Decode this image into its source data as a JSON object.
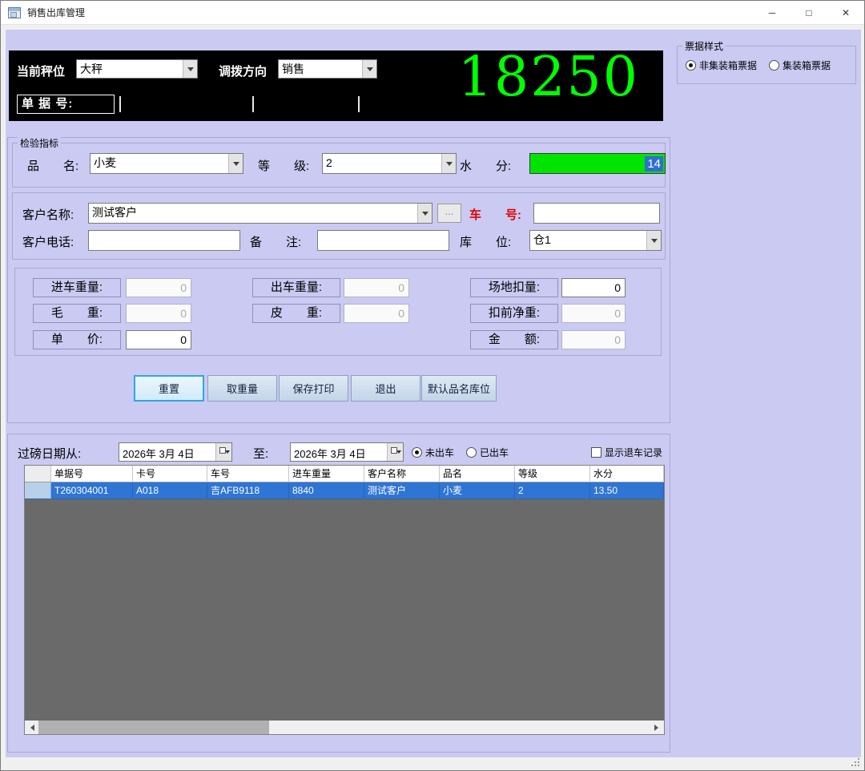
{
  "window": {
    "title": "销售出库管理",
    "controls": {
      "minimize": "─",
      "maximize": "□",
      "close": "✕"
    }
  },
  "scale_panel": {
    "scale_label": "当前秤位",
    "scale_value": "大秤",
    "direction_label": "调拨方向",
    "direction_value": "销售",
    "weight_display": "18250",
    "receipt_label": "单 据 号:"
  },
  "ticket_style": {
    "title": "票据样式",
    "option_non_container": "非集装箱票据",
    "option_container": "集装箱票据"
  },
  "inspection": {
    "title": "检验指标",
    "product_label": "品　　名:",
    "product_value": "小麦",
    "grade_label": "等　　级:",
    "grade_value": "2",
    "moisture_label": "水　　分:",
    "moisture_value": "14"
  },
  "customer": {
    "name_label": "客户名称:",
    "name_value": "测试客户",
    "browse_button": "...",
    "vehicle_label": "车　　号:",
    "vehicle_value": "",
    "phone_label": "客户电话:",
    "phone_value": "",
    "remark_label": "备　　注:",
    "remark_value": "",
    "warehouse_label": "库　　位:",
    "warehouse_value": "仓1"
  },
  "weights": {
    "in_label": "进车重量:",
    "in_value": "0",
    "out_label": "出车重量:",
    "out_value": "0",
    "site_deduct_label": "场地扣量:",
    "site_deduct_value": "0",
    "gross_label": "毛　　重:",
    "gross_value": "0",
    "tare_label": "皮　　重:",
    "tare_value": "0",
    "pre_net_label": "扣前净重:",
    "pre_net_value": "0",
    "price_label": "单　　价:",
    "price_value": "0",
    "amount_label": "金　　额:",
    "amount_value": "0"
  },
  "actions": {
    "reset": "重置",
    "get_weight": "取重量",
    "save_print": "保存打印",
    "exit": "退出",
    "default_product": "默认品名库位"
  },
  "filter": {
    "date_from_label": "过磅日期从:",
    "date_from_value": "2026年 3月 4日",
    "to_label": "至:",
    "date_to_value": "2026年 3月 4日",
    "not_out_label": "未出车",
    "out_label": "已出车",
    "show_return_label": "显示退车记录"
  },
  "table": {
    "headers": [
      "单据号",
      "卡号",
      "车号",
      "进车重量",
      "客户名称",
      "品名",
      "等级",
      "水分"
    ],
    "row": [
      "T260304001",
      "A018",
      "吉AFB9118",
      "8840",
      "测试客户",
      "小麦",
      "2",
      "13.50"
    ]
  }
}
